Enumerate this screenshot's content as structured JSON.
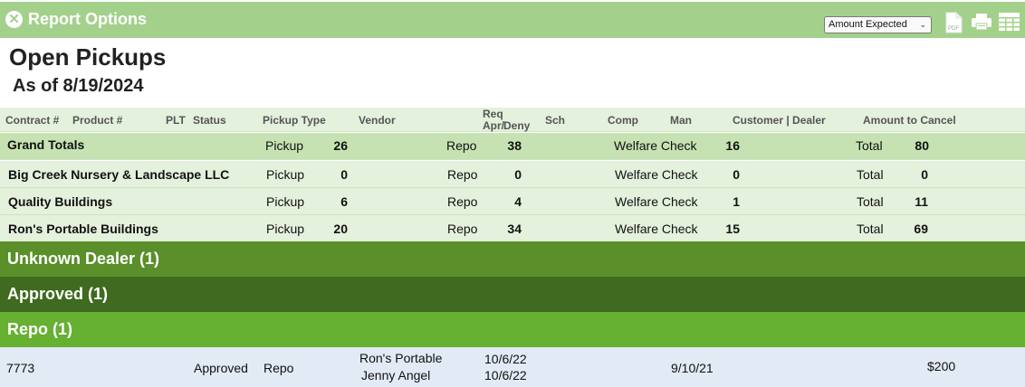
{
  "topbar": {
    "close_glyph": "✕",
    "title": "Report Options",
    "select_value": "Amount Expected",
    "pdf_text": "PDF",
    "icons": [
      "close-icon",
      "pdf-icon",
      "print-icon",
      "table-icon"
    ],
    "accent": "#a3d18b"
  },
  "report": {
    "title": "Open Pickups",
    "as_of": "As of 8/19/2024"
  },
  "columns": {
    "contract": "Contract #",
    "product": "Product #",
    "plt": "PLT",
    "status": "Status",
    "pickup_type": "Pickup Type",
    "vendor": "Vendor",
    "req": "Req",
    "apr": "Apr/",
    "deny": "Deny",
    "sch": "Sch",
    "comp": "Comp",
    "man": "Man",
    "customer_dealer": "Customer | Dealer",
    "amount_to_cancel": "Amount to Cancel"
  },
  "summary_rows": [
    {
      "name": "Grand Totals",
      "pickup_label": "Pickup",
      "pickup": "26",
      "repo_label": "Repo",
      "repo": "38",
      "welfare_label": "Welfare Check",
      "welfare": "16",
      "total_label": "Total",
      "total": "80"
    },
    {
      "name": "Big Creek Nursery & Landscape LLC",
      "pickup_label": "Pickup",
      "pickup": "0",
      "repo_label": "Repo",
      "repo": "0",
      "welfare_label": "Welfare Check",
      "welfare": "0",
      "total_label": "Total",
      "total": "0"
    },
    {
      "name": "Quality Buildings",
      "pickup_label": "Pickup",
      "pickup": "6",
      "repo_label": "Repo",
      "repo": "4",
      "welfare_label": "Welfare Check",
      "welfare": "1",
      "total_label": "Total",
      "total": "11"
    },
    {
      "name": "Ron's Portable Buildings",
      "pickup_label": "Pickup",
      "pickup": "20",
      "repo_label": "Repo",
      "repo": "34",
      "welfare_label": "Welfare Check",
      "welfare": "15",
      "total_label": "Total",
      "total": "69"
    }
  ],
  "groups": [
    {
      "label": "Unknown Dealer (1)",
      "color": "#5a8f2a"
    },
    {
      "label": "Approved (1)",
      "color": "#3f6a1f"
    },
    {
      "label": "Repo (1)",
      "color": "#66b032"
    }
  ],
  "detail": {
    "contract": "7773",
    "status": "Approved",
    "pickup_type": "Repo",
    "vendor": "Ron's Portable",
    "customer": "Jenny Angel",
    "req_date_1": "10/6/22",
    "req_date_2": "10/6/22",
    "man_date": "9/10/21",
    "amount": "$200",
    "row_color": "#e2eaf5"
  }
}
